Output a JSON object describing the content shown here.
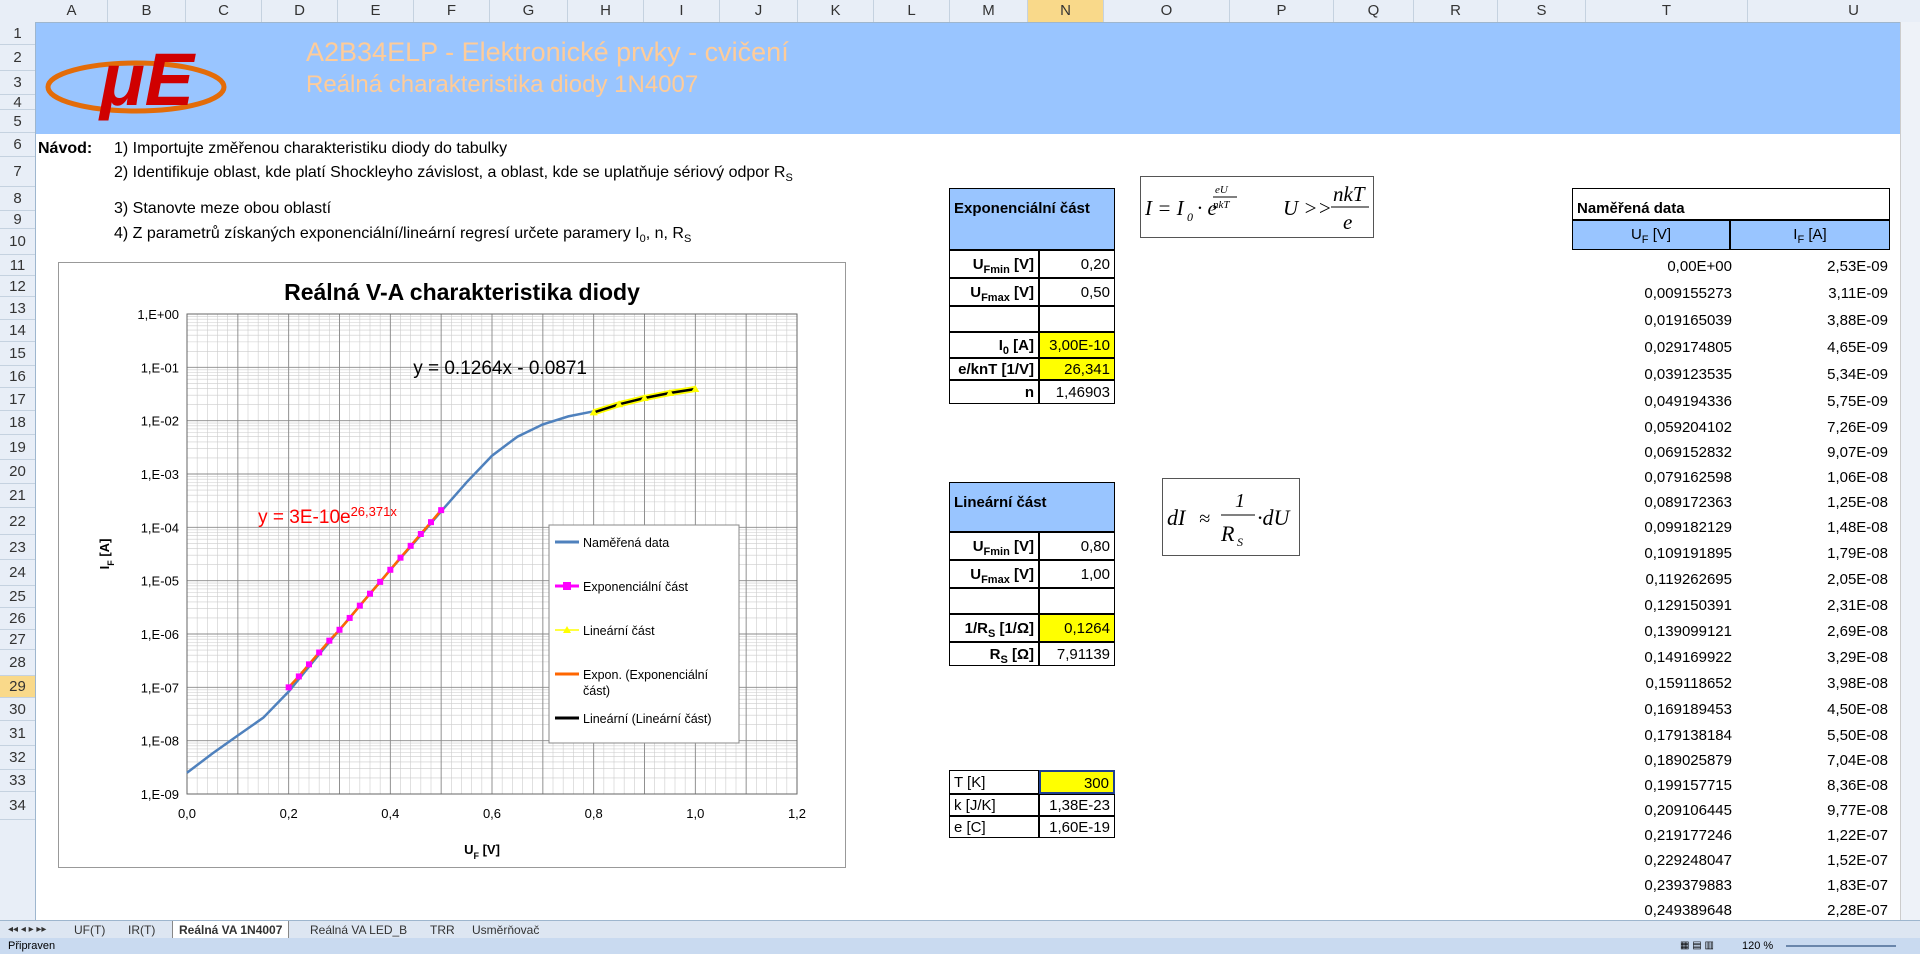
{
  "columns": [
    "A",
    "B",
    "C",
    "D",
    "E",
    "F",
    "G",
    "H",
    "I",
    "J",
    "K",
    "L",
    "M",
    "N",
    "O",
    "P",
    "Q",
    "R",
    "S",
    "T",
    "U"
  ],
  "rows": [
    "1",
    "2",
    "3",
    "4",
    "5",
    "6",
    "7",
    "8",
    "9",
    "10",
    "11",
    "12",
    "13",
    "14",
    "15",
    "16",
    "17",
    "18",
    "19",
    "20",
    "21",
    "22",
    "23",
    "24",
    "25",
    "26",
    "27",
    "28",
    "29",
    "30",
    "31",
    "32",
    "33",
    "34"
  ],
  "selected_column": "N",
  "selected_row": "29",
  "banner": {
    "logo_text": "μE",
    "title1": "A2B34ELP - Elektronické prvky - cvičení",
    "title2": "Reálná charakteristika diody 1N4007"
  },
  "instructions": {
    "label": "Návod:",
    "step1": "1) Importujte změřenou charakteristiku diody do tabulky",
    "step2": "2) Identifikuje oblast, kde platí Shockleyho závislost, a oblast, kde se uplatňuje sériový odpor R",
    "step2_sub": "S",
    "step3": "3) Stanovte meze obou oblastí",
    "step4": "4) Z parametrů získaných exponenciální/lineární regresí určete paramery I",
    "step4_sub0": "0",
    "step4_mid": ", n, R",
    "step4_sub1": "S"
  },
  "chart_data": {
    "type": "scatter",
    "title": "Reálná V-A charakteristika diody",
    "xlabel": "U",
    "xlabel_sub": "F",
    "xlabel_unit": " [V]",
    "ylabel": "I",
    "ylabel_sub": "F",
    "ylabel_unit": " [A]",
    "xlim": [
      0,
      1.2
    ],
    "ylim_log": [
      1e-09,
      1
    ],
    "y_scale": "log",
    "x_ticks": [
      "0,0",
      "0,2",
      "0,4",
      "0,6",
      "0,8",
      "1,0",
      "1,2"
    ],
    "y_ticks": [
      "1,E+00",
      "1,E-01",
      "1,E-02",
      "1,E-03",
      "1,E-04",
      "1,E-05",
      "1,E-06",
      "1,E-07",
      "1,E-08",
      "1,E-09"
    ],
    "grid": true,
    "legend_position": "right",
    "eq_linear": "y = 0.1264x - 0.0871",
    "eq_exp_prefix": "y = 3E-10e",
    "eq_exp_sup": "26,371x",
    "legend": [
      {
        "name": "Naměřená data",
        "color": "#4f81bd"
      },
      {
        "name": "Exponenciální část",
        "color": "#ff00ff"
      },
      {
        "name": "Lineární část",
        "color": "#ffff00"
      },
      {
        "name": "Expon. (Exponenciální část)",
        "color": "#ff6600"
      },
      {
        "name": "Lineární (Lineární část)",
        "color": "#000000"
      }
    ],
    "series": [
      {
        "name": "Naměřená data",
        "x": [
          0,
          0.05,
          0.1,
          0.15,
          0.2,
          0.25,
          0.3,
          0.35,
          0.4,
          0.45,
          0.5,
          0.55,
          0.6,
          0.65,
          0.7,
          0.75,
          0.8,
          0.85,
          0.9,
          0.95,
          1.0
        ],
        "y": [
          2.5e-09,
          5.75e-09,
          1.25e-08,
          2.69e-08,
          8.36e-08,
          3.2e-07,
          1.2e-06,
          4.4e-06,
          1.6e-05,
          5.6e-05,
          0.0002,
          0.0007,
          0.0022,
          0.005,
          0.0085,
          0.012,
          0.015,
          0.019,
          0.025,
          0.031,
          0.038
        ]
      },
      {
        "name": "Exponenciální část",
        "x": [
          0.2,
          0.22,
          0.24,
          0.26,
          0.28,
          0.3,
          0.32,
          0.34,
          0.36,
          0.38,
          0.4,
          0.42,
          0.44,
          0.46,
          0.48,
          0.5
        ],
        "y": [
          1e-07,
          1.6e-07,
          2.7e-07,
          4.5e-07,
          7.5e-07,
          1.2e-06,
          2e-06,
          3.4e-06,
          5.7e-06,
          9.5e-06,
          1.6e-05,
          2.7e-05,
          4.5e-05,
          7.5e-05,
          0.000125,
          0.00021
        ]
      },
      {
        "name": "Lineární část",
        "x": [
          0.8,
          0.85,
          0.9,
          0.95,
          1.0
        ],
        "y": [
          0.0143,
          0.0203,
          0.0266,
          0.033,
          0.0393
        ]
      }
    ]
  },
  "exp_table": {
    "header": "Exponenciální část",
    "rows": [
      {
        "label": "U",
        "sub": "Fmin",
        "unit": " [V]",
        "value": "0,20",
        "yellow": false
      },
      {
        "label": "U",
        "sub": "Fmax",
        "unit": " [V]",
        "value": "0,50",
        "yellow": false
      },
      {
        "label": "",
        "sub": "",
        "unit": "",
        "value": "",
        "yellow": false
      },
      {
        "label": "I",
        "sub": "0",
        "unit": " [A]",
        "value": "3,00E-10",
        "yellow": true
      },
      {
        "label": "e/knT  [1/V]",
        "sub": "",
        "unit": "",
        "value": "26,341",
        "yellow": true
      },
      {
        "label": "n",
        "sub": "",
        "unit": "",
        "value": "1,46903",
        "yellow": false
      }
    ]
  },
  "lin_table": {
    "header": "Lineární část",
    "rows": [
      {
        "label": "U",
        "sub": "Fmin",
        "unit": " [V]",
        "value": "0,80",
        "yellow": false
      },
      {
        "label": "U",
        "sub": "Fmax",
        "unit": " [V]",
        "value": "1,00",
        "yellow": false
      },
      {
        "label": "",
        "sub": "",
        "unit": "",
        "value": "",
        "yellow": false
      },
      {
        "label": "1/R",
        "sub": "S",
        "unit": " [1/Ω]",
        "value": "0,1264",
        "yellow": true
      },
      {
        "label": "R",
        "sub": "S",
        "unit": " [Ω]",
        "value": "7,91139",
        "yellow": false
      }
    ]
  },
  "const_table": {
    "rows": [
      {
        "label": "T [K]",
        "value": "300",
        "yellow": true
      },
      {
        "label": "k [J/K]",
        "value": "1,38E-23",
        "yellow": false
      },
      {
        "label": "e [C]",
        "value": "1,60E-19",
        "yellow": false
      }
    ]
  },
  "measured": {
    "title": "Naměřená data",
    "col1": "U",
    "col1_sub": "F",
    "col1_unit": " [V]",
    "col2": "I",
    "col2_sub": "F",
    "col2_unit": " [A]",
    "u": [
      "0,00E+00",
      "0,009155273",
      "0,019165039",
      "0,029174805",
      "0,039123535",
      "0,049194336",
      "0,059204102",
      "0,069152832",
      "0,079162598",
      "0,089172363",
      "0,099182129",
      "0,109191895",
      "0,119262695",
      "0,129150391",
      "0,139099121",
      "0,149169922",
      "0,159118652",
      "0,169189453",
      "0,179138184",
      "0,189025879",
      "0,199157715",
      "0,209106445",
      "0,219177246",
      "0,229248047",
      "0,239379883",
      "0,249389648"
    ],
    "i": [
      "2,53E-09",
      "3,11E-09",
      "3,88E-09",
      "4,65E-09",
      "5,34E-09",
      "5,75E-09",
      "7,26E-09",
      "9,07E-09",
      "1,06E-08",
      "1,25E-08",
      "1,48E-08",
      "1,79E-08",
      "2,05E-08",
      "2,31E-08",
      "2,69E-08",
      "3,29E-08",
      "3,98E-08",
      "4,50E-08",
      "5,50E-08",
      "7,04E-08",
      "8,36E-08",
      "9,77E-08",
      "1,22E-07",
      "1,52E-07",
      "1,83E-07",
      "2,28E-07"
    ]
  },
  "sheet_tabs": [
    "UF(T)",
    "IR(T)",
    "Reálná VA 1N4007",
    "Reálná VA LED_B",
    "TRR",
    "Usměrňovač"
  ],
  "active_tab": "Reálná VA 1N4007",
  "status": {
    "ready": "Připraven",
    "zoom": "120 %"
  },
  "colors": {
    "banner": "#99c5ff",
    "banner_text": "#ffcc99",
    "header_fill": "#99c5ff",
    "highlight": "#ffff00"
  }
}
